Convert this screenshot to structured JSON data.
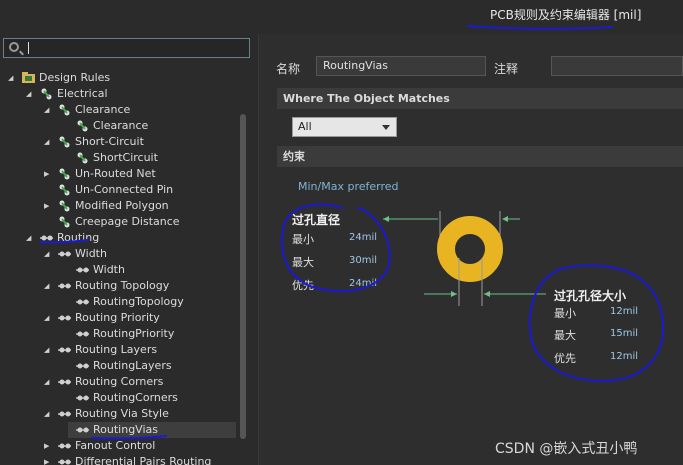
{
  "window": {
    "title": "PCB规则及约束编辑器 [mil]"
  },
  "search": {
    "value": ""
  },
  "tree": [
    {
      "label": "Design Rules",
      "level": 0,
      "expander": "open",
      "icon": "design-rules-folder-icon"
    },
    {
      "label": "Electrical",
      "level": 1,
      "expander": "open",
      "icon": "rule-category-icon"
    },
    {
      "label": "Clearance",
      "level": 2,
      "expander": "open",
      "icon": "rule-category-icon"
    },
    {
      "label": "Clearance",
      "level": 3,
      "expander": "none",
      "icon": "rule-icon"
    },
    {
      "label": "Short-Circuit",
      "level": 2,
      "expander": "open",
      "icon": "rule-category-icon"
    },
    {
      "label": "ShortCircuit",
      "level": 3,
      "expander": "none",
      "icon": "rule-icon"
    },
    {
      "label": "Un-Routed Net",
      "level": 2,
      "expander": "closed",
      "icon": "rule-category-icon"
    },
    {
      "label": "Un-Connected Pin",
      "level": 2,
      "expander": "none",
      "icon": "rule-category-icon"
    },
    {
      "label": "Modified Polygon",
      "level": 2,
      "expander": "closed",
      "icon": "rule-category-icon"
    },
    {
      "label": "Creepage Distance",
      "level": 2,
      "expander": "none",
      "icon": "rule-category-icon"
    },
    {
      "label": "Routing",
      "level": 1,
      "expander": "open",
      "icon": "routing-category-icon"
    },
    {
      "label": "Width",
      "level": 2,
      "expander": "open",
      "icon": "routing-category-icon"
    },
    {
      "label": "Width",
      "level": 3,
      "expander": "none",
      "icon": "routing-rule-icon"
    },
    {
      "label": "Routing Topology",
      "level": 2,
      "expander": "open",
      "icon": "routing-category-icon"
    },
    {
      "label": "RoutingTopology",
      "level": 3,
      "expander": "none",
      "icon": "routing-rule-icon"
    },
    {
      "label": "Routing Priority",
      "level": 2,
      "expander": "open",
      "icon": "routing-category-icon"
    },
    {
      "label": "RoutingPriority",
      "level": 3,
      "expander": "none",
      "icon": "routing-rule-icon"
    },
    {
      "label": "Routing Layers",
      "level": 2,
      "expander": "open",
      "icon": "routing-category-icon"
    },
    {
      "label": "RoutingLayers",
      "level": 3,
      "expander": "none",
      "icon": "routing-rule-icon"
    },
    {
      "label": "Routing Corners",
      "level": 2,
      "expander": "open",
      "icon": "routing-category-icon"
    },
    {
      "label": "RoutingCorners",
      "level": 3,
      "expander": "none",
      "icon": "routing-rule-icon"
    },
    {
      "label": "Routing Via Style",
      "level": 2,
      "expander": "open",
      "icon": "routing-category-icon"
    },
    {
      "label": "RoutingVias",
      "level": 3,
      "expander": "none",
      "icon": "routing-rule-icon",
      "selected": true
    },
    {
      "label": "Fanout Control",
      "level": 2,
      "expander": "closed",
      "icon": "routing-category-icon"
    },
    {
      "label": "Differential Pairs Routing",
      "level": 2,
      "expander": "closed",
      "icon": "routing-category-icon"
    }
  ],
  "form": {
    "name_label": "名称",
    "name_value": "RoutingVias",
    "comment_label": "注释",
    "comment_value": "",
    "match_section": "Where The Object Matches",
    "match_option": "All",
    "constraints_section": "约束",
    "preference": "Min/Max preferred"
  },
  "via_diameter": {
    "title": "过孔直径",
    "min_label": "最小",
    "min_value": "24mil",
    "max_label": "最大",
    "max_value": "30mil",
    "pref_label": "优先",
    "pref_value": "24mil"
  },
  "via_hole": {
    "title": "过孔孔径大小",
    "min_label": "最小",
    "min_value": "12mil",
    "max_label": "最大",
    "max_value": "15mil",
    "pref_label": "优先",
    "pref_value": "12mil"
  },
  "watermark": "CSDN @嵌入式丑小鸭",
  "colors": {
    "via_ring": "#e8b422",
    "annotation": "#1a1ad6",
    "dimension": "#6fbf8a"
  }
}
